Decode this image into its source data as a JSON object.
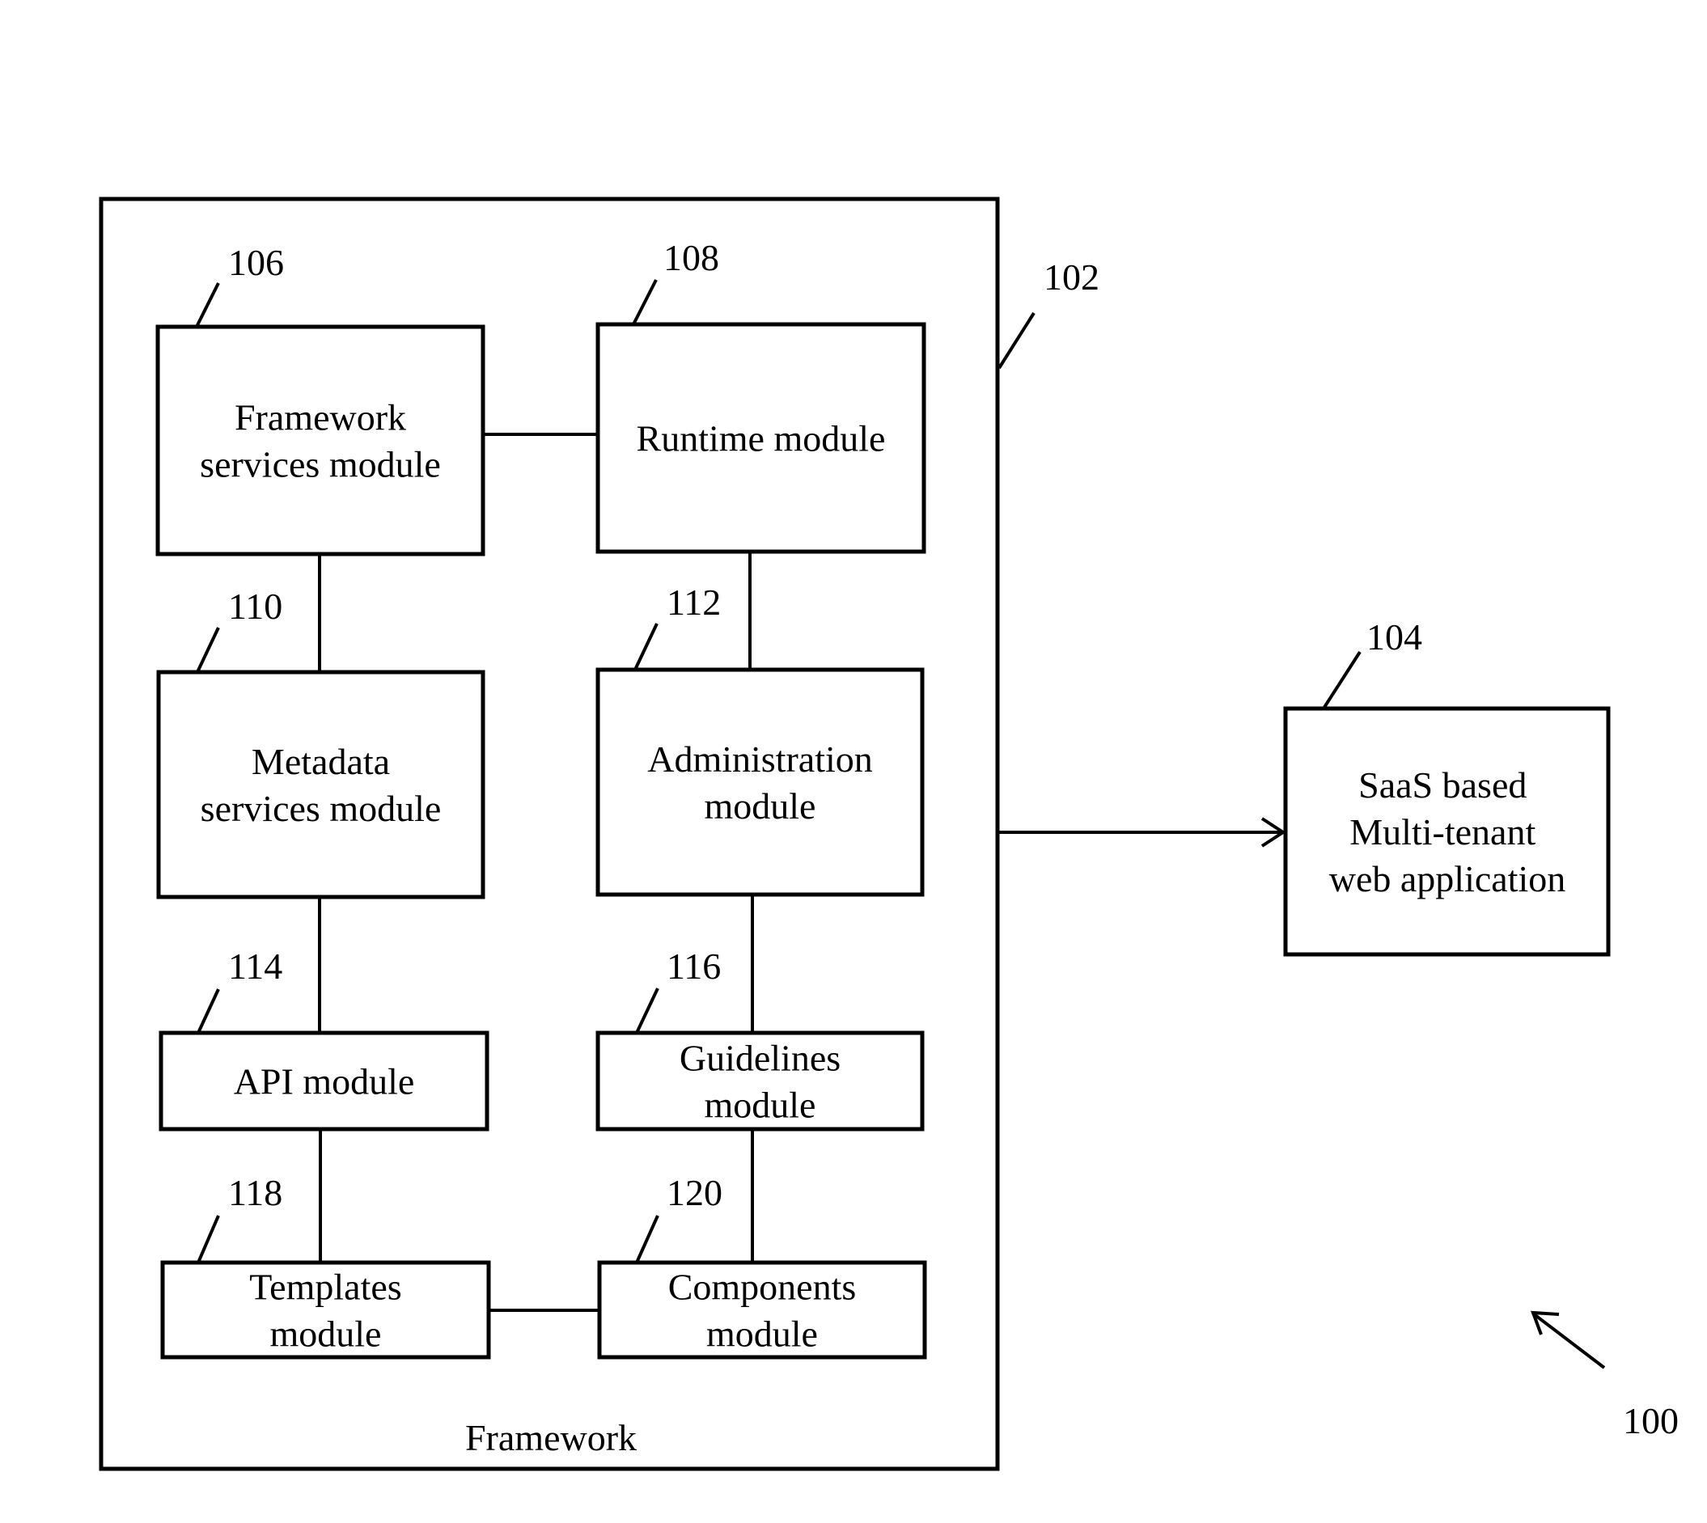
{
  "figure": {
    "ref": "100",
    "framework": {
      "ref": "102",
      "label": "Framework"
    },
    "application": {
      "ref": "104",
      "lines": [
        "SaaS based",
        "Multi-tenant",
        "web application"
      ]
    },
    "modules": [
      {
        "id": "framework-services",
        "ref": "106",
        "lines": [
          "Framework",
          "services module"
        ]
      },
      {
        "id": "runtime",
        "ref": "108",
        "lines": [
          "Runtime module"
        ]
      },
      {
        "id": "metadata-services",
        "ref": "110",
        "lines": [
          "Metadata",
          "services module"
        ]
      },
      {
        "id": "administration",
        "ref": "112",
        "lines": [
          "Administration",
          "module"
        ]
      },
      {
        "id": "api",
        "ref": "114",
        "lines": [
          "API module"
        ]
      },
      {
        "id": "guidelines",
        "ref": "116",
        "lines": [
          "Guidelines",
          "module"
        ]
      },
      {
        "id": "templates",
        "ref": "118",
        "lines": [
          "Templates",
          "module"
        ]
      },
      {
        "id": "components",
        "ref": "120",
        "lines": [
          "Components",
          "module"
        ]
      }
    ],
    "connections": [
      [
        "framework-services",
        "runtime"
      ],
      [
        "framework-services",
        "metadata-services"
      ],
      [
        "runtime",
        "administration"
      ],
      [
        "metadata-services",
        "api"
      ],
      [
        "administration",
        "guidelines"
      ],
      [
        "api",
        "templates"
      ],
      [
        "guidelines",
        "components"
      ],
      [
        "templates",
        "components"
      ],
      [
        "framework",
        "application"
      ]
    ]
  }
}
